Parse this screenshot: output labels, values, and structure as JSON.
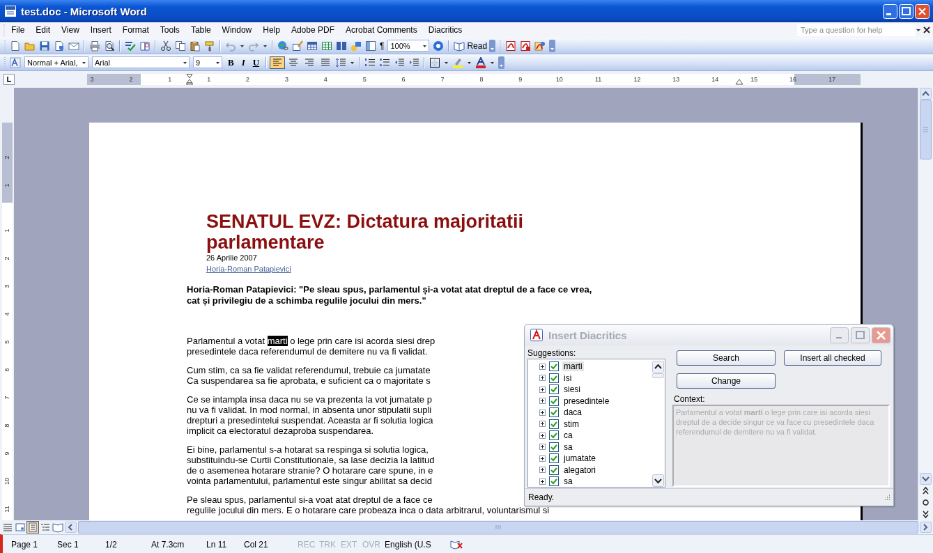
{
  "window": {
    "title": "test.doc - Microsoft Word"
  },
  "menu": [
    "File",
    "Edit",
    "View",
    "Insert",
    "Format",
    "Tools",
    "Table",
    "Window",
    "Help",
    "Adobe PDF",
    "Acrobat Comments",
    "Diacritics"
  ],
  "help_search": {
    "placeholder": "Type a question for help"
  },
  "standard_toolbar": {
    "show_marks": "¶",
    "zoom": "100%",
    "read": "Read"
  },
  "formatting_toolbar": {
    "style": "Normal + Arial,",
    "font": "Arial",
    "size": "9",
    "bold": "B",
    "italic": "I",
    "underline": "U",
    "alignment": [
      {
        "selected": true
      },
      {
        "selected": false
      },
      {
        "selected": false
      },
      {
        "selected": false
      }
    ]
  },
  "ruler": {
    "labels": [
      "3",
      "2",
      "1",
      "1",
      "2",
      "3",
      "4",
      "5",
      "6",
      "7",
      "8",
      "9",
      "10",
      "11",
      "12",
      "13",
      "14",
      "15",
      "16",
      "17"
    ]
  },
  "vertical_ruler": {
    "labels": [
      "2",
      "1",
      "1",
      "2",
      "3",
      "4",
      "5",
      "6",
      "7",
      "8",
      "9",
      "10",
      "11"
    ]
  },
  "document": {
    "title": "SENATUL EVZ: Dictatura majoritatii parlamentare",
    "date": "26 Aprilie 2007",
    "author": "Horia-Roman Patapievici",
    "lead": [
      "Horia-Roman Patapievici: \"Pe sleau spus, parlamentul și-a votat atat dreptul de a face ce vrea,",
      "cat și privilegiu de a schimba regulile jocului din mers.\""
    ],
    "paragraphs": [
      [
        {
          "before": "Parlamentul a votat ",
          "selection": "marti",
          "after": " o lege prin care isi acorda siesi drep"
        },
        "presedintele daca referendumul de demitere nu va fi validat."
      ],
      [
        "Cum stim, ca sa fie validat referendumul, trebuie ca jumatate",
        "Ca suspendarea sa fie aprobata, e suficient ca o majoritate s"
      ],
      [
        "Ce se intampla insa daca nu se va prezenta la vot jumatate p",
        "nu va fi validat. In mod normal, in absenta unor stipulatii supli",
        "drepturi a presedintelui suspendat. Aceasta ar fi solutia logica",
        "implicit ca electoratul dezaproba suspendarea."
      ],
      [
        "Ei bine, parlamentul s-a hotarat sa respinga si solutia logica,",
        "substituindu-se Curtii Constitutionale, sa lase decizia la latitud",
        "de o asemenea hotarare stranie? O hotarare care spune, in e",
        "vointa parlamentului, parlamentul este singur abilitat sa decid"
      ],
      [
        "Pe sleau spus, parlamentul si-a voat atat dreptul de a face ce",
        "regulile jocului din mers. E o hotarare care probeaza inca o data arbitrarul, voluntarismul si"
      ]
    ]
  },
  "view_buttons": [
    {
      "selected": false
    },
    {
      "selected": false
    },
    {
      "selected": true
    },
    {
      "selected": false
    },
    {
      "selected": false
    }
  ],
  "status_bar": [
    {
      "text": "Page 1",
      "disabled": false
    },
    {
      "text": "Sec 1",
      "disabled": false
    },
    {
      "text": "1/2",
      "disabled": false
    },
    {
      "text": "At 7.3cm",
      "disabled": false
    },
    {
      "text": "Ln 11",
      "disabled": false
    },
    {
      "text": "Col 21",
      "disabled": false
    },
    {
      "text": "REC",
      "disabled": true
    },
    {
      "text": "TRK",
      "disabled": true
    },
    {
      "text": "EXT",
      "disabled": true
    },
    {
      "text": "OVR",
      "disabled": true
    },
    {
      "text": "English (U.S",
      "disabled": false
    }
  ],
  "dialog": {
    "title": "Insert Diacritics",
    "suggestions_label": "Suggestions:",
    "suggestions": [
      {
        "word": "marti",
        "checked": true,
        "expanded": false,
        "selected": true
      },
      {
        "word": "isi",
        "checked": true,
        "expanded": false,
        "selected": false
      },
      {
        "word": "siesi",
        "checked": true,
        "expanded": false,
        "selected": false
      },
      {
        "word": "presedintele",
        "checked": true,
        "expanded": false,
        "selected": false
      },
      {
        "word": "daca",
        "checked": true,
        "expanded": false,
        "selected": false
      },
      {
        "word": "stim",
        "checked": true,
        "expanded": false,
        "selected": false
      },
      {
        "word": "ca",
        "checked": true,
        "expanded": false,
        "selected": false
      },
      {
        "word": "sa",
        "checked": true,
        "expanded": false,
        "selected": false
      },
      {
        "word": "jumatate",
        "checked": true,
        "expanded": false,
        "selected": false
      },
      {
        "word": "alegatori",
        "checked": true,
        "expanded": false,
        "selected": false
      },
      {
        "word": "sa",
        "checked": true,
        "expanded": false,
        "selected": false
      }
    ],
    "buttons": [
      "Search",
      "Insert all checked",
      "Change"
    ],
    "context_label": "Context:",
    "context": "Parlamentul a votat **marti** o lege prin care isi acorda siesi dreptul de a decide singur ce va face cu presedintele daca referendumul de demitere nu va fi validat.",
    "status": "Ready."
  }
}
